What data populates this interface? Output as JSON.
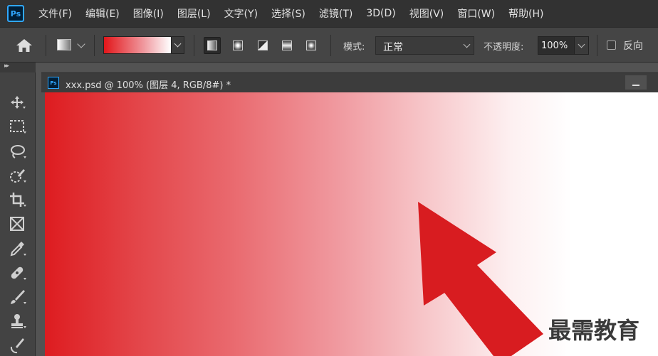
{
  "app": {
    "logo_text": "Ps"
  },
  "menu": [
    {
      "label": "文件(F)"
    },
    {
      "label": "编辑(E)"
    },
    {
      "label": "图像(I)"
    },
    {
      "label": "图层(L)"
    },
    {
      "label": "文字(Y)"
    },
    {
      "label": "选择(S)"
    },
    {
      "label": "滤镜(T)"
    },
    {
      "label": "3D(D)"
    },
    {
      "label": "视图(V)"
    },
    {
      "label": "窗口(W)"
    },
    {
      "label": "帮助(H)"
    }
  ],
  "options": {
    "mode_label": "模式:",
    "mode_value": "正常",
    "opacity_label": "不透明度:",
    "opacity_value": "100%",
    "reverse_label": "反向",
    "gradient_colors": [
      "#e2161a",
      "#ffffff"
    ],
    "active_gradient_type": "linear"
  },
  "document": {
    "icon_text": "Ps",
    "title": "xxx.psd @ 100% (图层 4, RGB/8#) *"
  },
  "watermark": "最需教育",
  "colors": {
    "accent": "#31a8ff",
    "arrow": "#d81c20",
    "canvas_start": "#de1c20"
  }
}
